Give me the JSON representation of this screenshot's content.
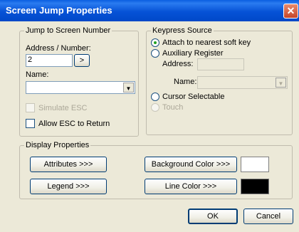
{
  "window": {
    "title": "Screen Jump Properties",
    "close_glyph": "✕"
  },
  "jump": {
    "group_label": "Jump to Screen Number",
    "address_label": "Address / Number:",
    "address_value": "2",
    "browse_label": ">",
    "name_label": "Name:",
    "name_value": "",
    "simulate_esc_label": "Simulate ESC",
    "allow_esc_label": "Allow ESC to Return"
  },
  "keypress": {
    "group_label": "Keypress Source",
    "attach_label": "Attach to nearest soft key",
    "aux_label": "Auxiliary Register",
    "address_label": "Address:",
    "name_label": "Name:",
    "cursor_label": "Cursor Selectable",
    "touch_label": "Touch",
    "selected": "attach"
  },
  "display": {
    "group_label": "Display Properties",
    "attributes_label": "Attributes >>>",
    "legend_label": "Legend >>>",
    "bg_color_label": "Background Color >>>",
    "line_color_label": "Line Color >>>",
    "bg_color": "#ffffff",
    "line_color": "#000000"
  },
  "footer": {
    "ok_label": "OK",
    "cancel_label": "Cancel"
  }
}
